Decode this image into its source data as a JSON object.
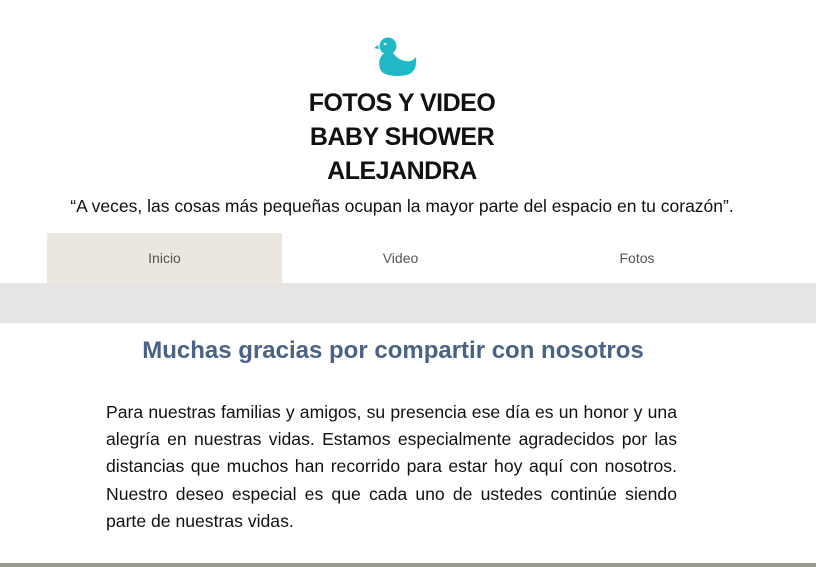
{
  "header": {
    "logo_icon": "duck-icon",
    "logo_color": "#1fb8c4",
    "title_lines": [
      "FOTOS Y VIDEO",
      "BABY SHOWER",
      "ALEJANDRA"
    ],
    "quote": "“A veces, las cosas más pequeñas ocupan la mayor parte del espacio en tu corazón”."
  },
  "nav": {
    "items": [
      {
        "label": "Inicio",
        "active": true
      },
      {
        "label": "Video",
        "active": false
      },
      {
        "label": "Fotos",
        "active": false
      }
    ],
    "active_bg": "#ebe7df"
  },
  "main": {
    "heading": "Muchas gracias por compartir con nosotros",
    "heading_color": "#4a6286",
    "paragraph": "Para nuestras familias y amigos, su presencia ese día es un honor y una alegría en nuestras vidas. Estamos especialmente agradecidos por las distancias que muchos han recorrido para estar hoy aquí con nosotros. Nuestro deseo especial es que cada uno de ustedes continúe siendo parte de nuestras vidas."
  }
}
